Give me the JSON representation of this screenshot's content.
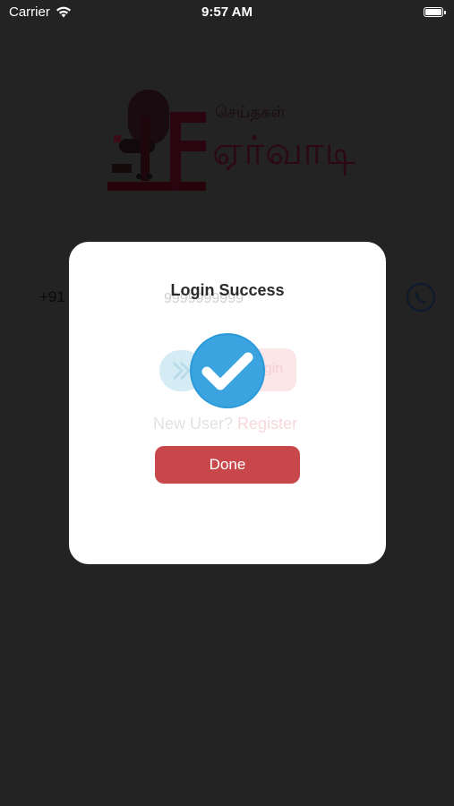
{
  "status_bar": {
    "carrier": "Carrier",
    "time": "9:57 AM",
    "wifi_icon": "wifi-icon",
    "battery_icon": "battery-full-icon"
  },
  "background": {
    "logo_small_text": "செய்தகள்",
    "logo_big_text": "ஏர்வாடி",
    "country_code": "+91",
    "phone_number": "9999999999",
    "login_label": "Login",
    "new_user_label": "New User?",
    "register_label": "Register",
    "phone_icon": "phone-icon"
  },
  "modal": {
    "title": "Login Success",
    "success_icon": "check-circle-icon",
    "done_label": "Done"
  },
  "colors": {
    "overlay_background": "#232323",
    "modal_background": "#ffffff",
    "done_button": "#c8474a",
    "check_circle": "#2b9ad9"
  }
}
